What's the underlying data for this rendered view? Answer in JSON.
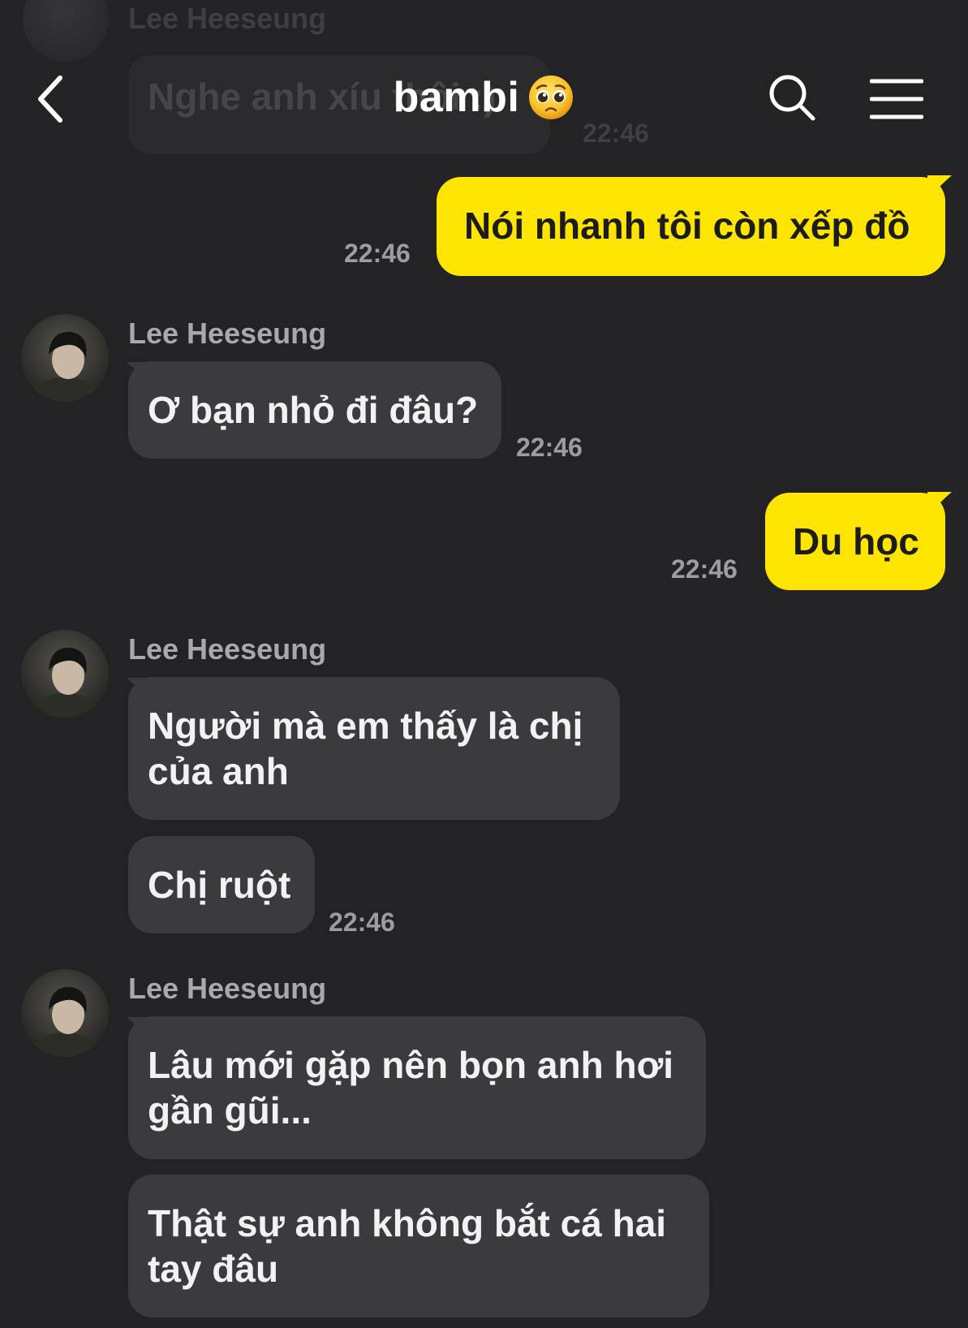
{
  "ghost": {
    "name": "Lee Heeseung",
    "text": "Nghe anh xíu thôi :)",
    "time": "22:46"
  },
  "header": {
    "title": "bambi",
    "emoji": "pleading-face-emoji",
    "back_icon": "chevron-left-icon",
    "search_icon": "search-icon",
    "menu_icon": "hamburger-menu-icon"
  },
  "colors": {
    "background": "#232326",
    "outgoing_bubble": "#fee500",
    "incoming_bubble": "#3a3a3f",
    "timestamp": "#9c9ca2"
  },
  "messages": [
    {
      "direction": "out",
      "text": "Nói nhanh tôi còn xếp đồ",
      "time": "22:46"
    },
    {
      "direction": "in",
      "sender": "Lee Heeseung",
      "text": "Ơ bạn nhỏ đi đâu?",
      "time": "22:46"
    },
    {
      "direction": "out",
      "text": "Du học",
      "time": "22:46"
    },
    {
      "direction": "in",
      "sender": "Lee Heeseung",
      "lines": [
        "Người mà em thấy là chị",
        "của anh"
      ]
    },
    {
      "direction": "in",
      "text": "Chị ruột",
      "time": "22:46"
    },
    {
      "direction": "in",
      "sender": "Lee Heeseung",
      "lines": [
        "Lâu mới gặp nên bọn anh hơi",
        "gần gũi..."
      ]
    },
    {
      "direction": "in",
      "lines": [
        "Thật sự anh không bắt cá hai",
        "tay đâu"
      ]
    }
  ]
}
